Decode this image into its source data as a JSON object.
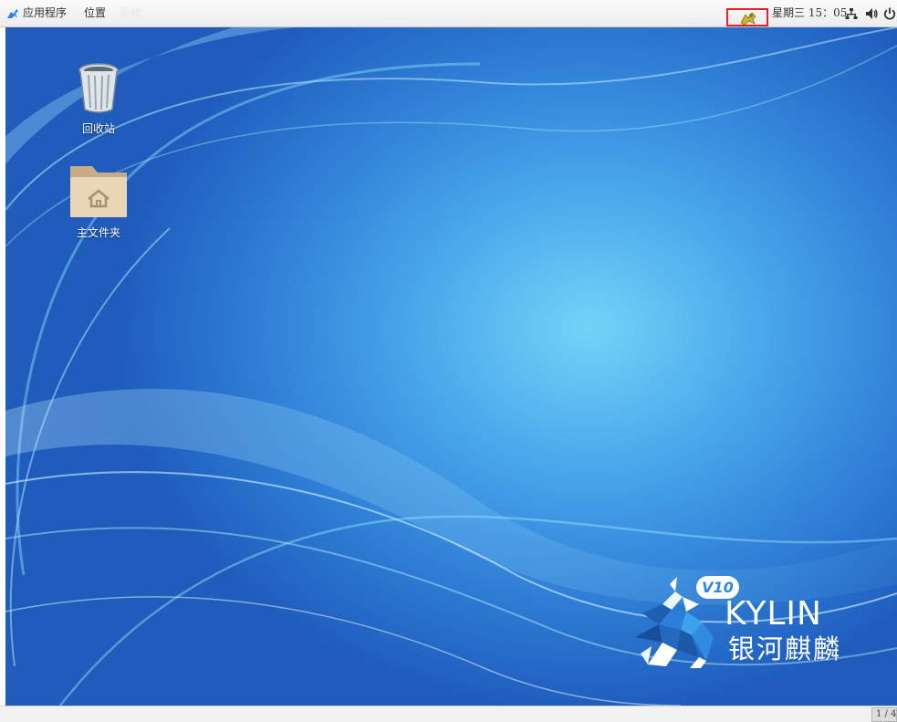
{
  "top_panel": {
    "apps_menu": "应用程序",
    "places_menu": "位置",
    "hidden_menu": "系统",
    "clock": "星期三 15：05"
  },
  "desktop": {
    "icons": [
      {
        "label": "回收站",
        "icon": "trash-icon"
      },
      {
        "label": "主文件夹",
        "icon": "home-folder-icon"
      }
    ],
    "logo": {
      "version": "V10",
      "brand": "KYLIN",
      "brand_cn": "银河麒麟"
    }
  },
  "bottom_panel": {
    "workspace": "1 / 4"
  },
  "colors": {
    "tray_highlight": "#e0232a",
    "desktop_center": "#74d3f7",
    "desktop_edge": "#1f5cbc"
  }
}
